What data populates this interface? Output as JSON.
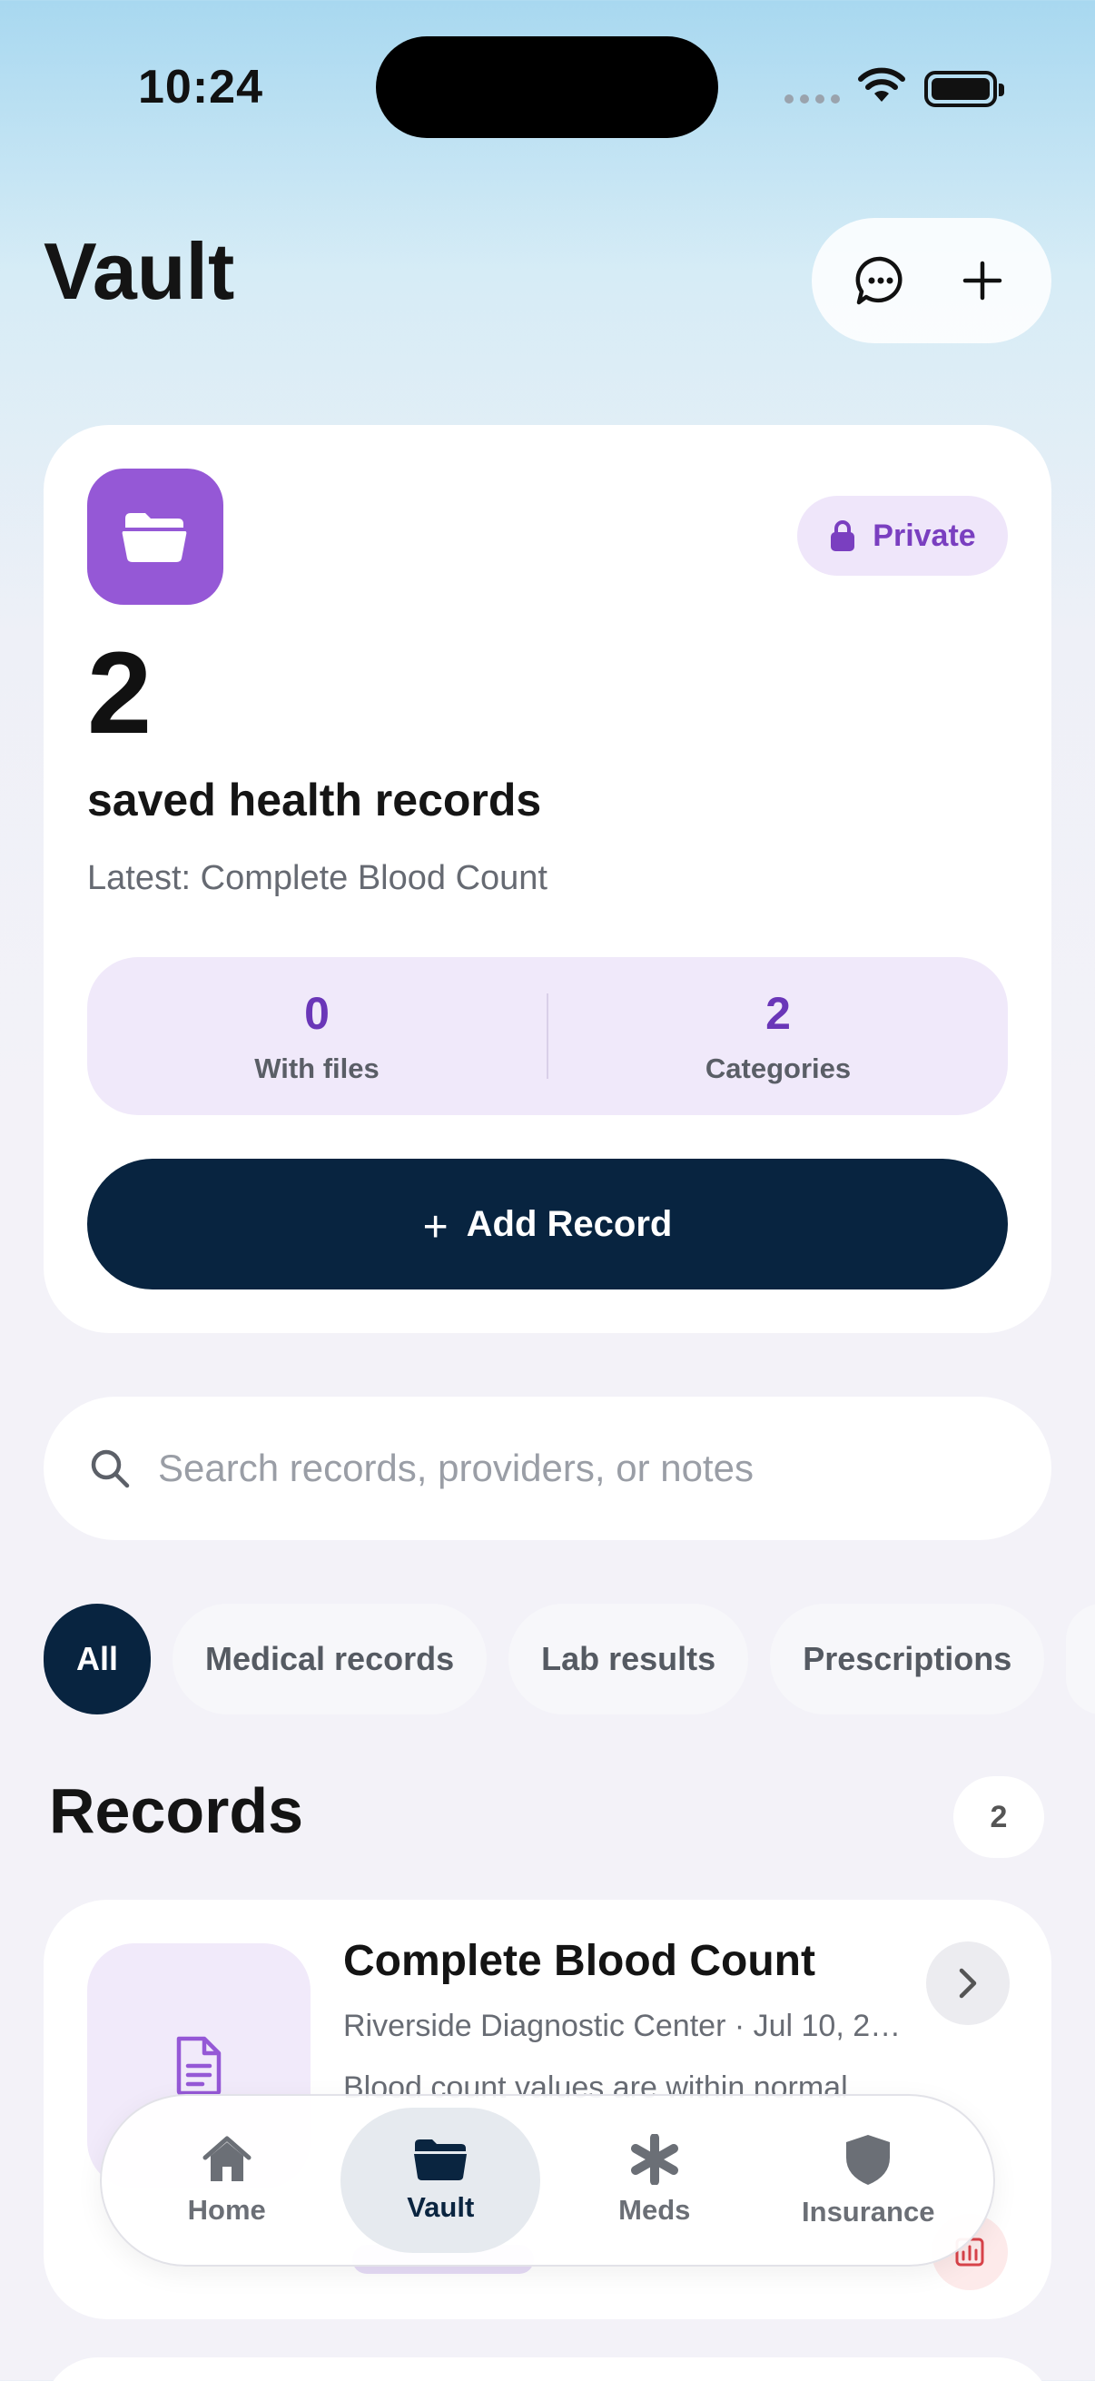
{
  "status_bar": {
    "time": "10:24"
  },
  "header": {
    "title": "Vault"
  },
  "summary": {
    "badge_label": "Private",
    "count": "2",
    "subtitle": "saved health records",
    "latest": "Latest: Complete Blood Count",
    "stats": [
      {
        "value": "0",
        "label": "With files"
      },
      {
        "value": "2",
        "label": "Categories"
      }
    ],
    "add_button": {
      "icon": "+",
      "label": "Add Record"
    }
  },
  "search": {
    "placeholder": "Search records, providers, or notes"
  },
  "filters": [
    {
      "label": "All",
      "active": true
    },
    {
      "label": "Medical records"
    },
    {
      "label": "Lab results"
    },
    {
      "label": "Prescriptions"
    }
  ],
  "records": {
    "title": "Records",
    "count": "2",
    "items": [
      {
        "title": "Complete Blood Count",
        "meta": "Riverside Diagnostic Center · Jul 10, 20...",
        "snippet": "Blood count values are within normal"
      }
    ]
  },
  "tabbar": {
    "tabs": [
      {
        "label": "Home",
        "icon": "house-icon"
      },
      {
        "label": "Vault",
        "icon": "folder-icon",
        "active": true
      },
      {
        "label": "Meds",
        "icon": "asterisk-icon"
      },
      {
        "label": "Insurance",
        "icon": "shield-icon"
      }
    ]
  },
  "colors": {
    "accent_purple": "#9558d6",
    "navy": "#082440",
    "stats_bg": "#f0e9fa"
  }
}
